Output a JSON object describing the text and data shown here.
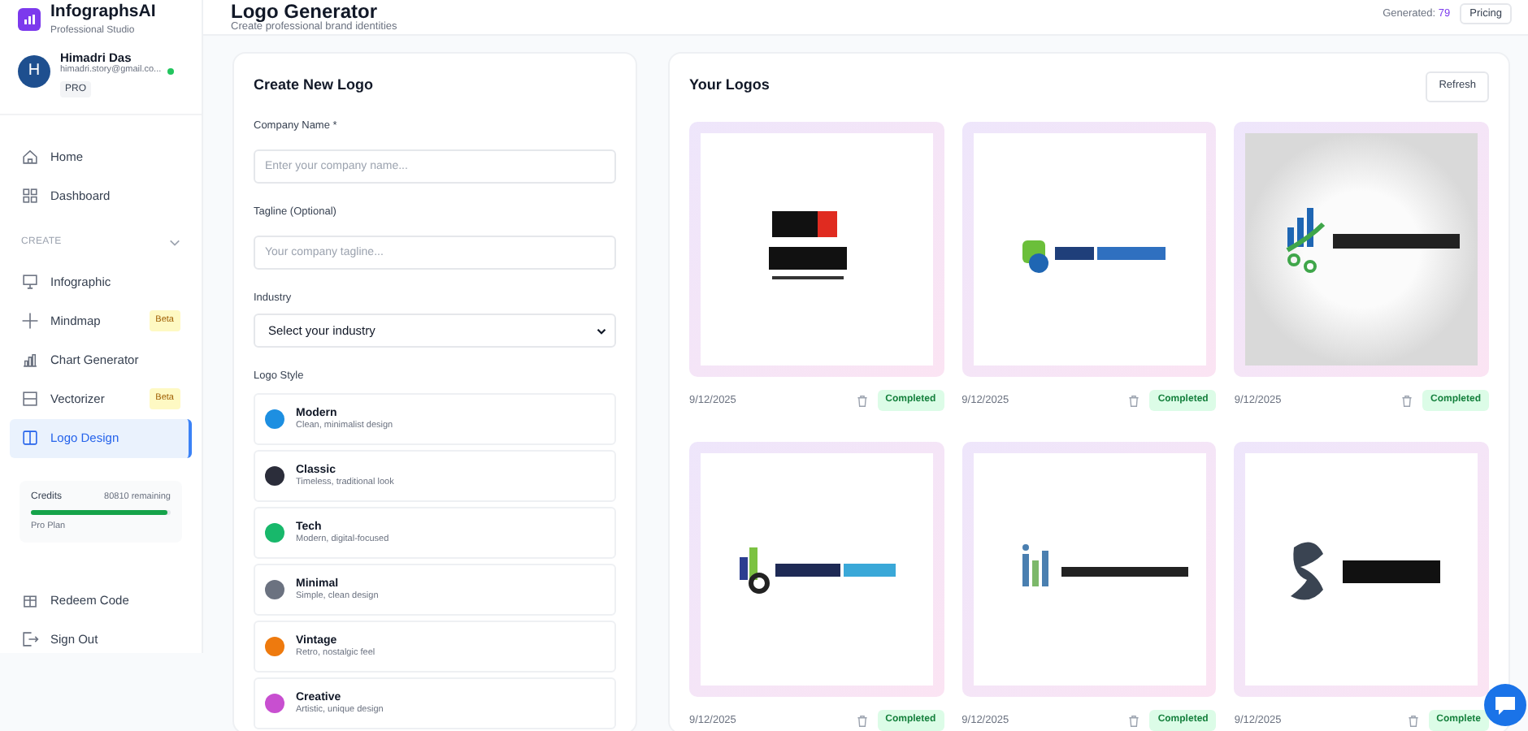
{
  "sidebar": {
    "brand": {
      "name": "InfographsAI",
      "subtitle": "Professional Studio"
    },
    "user": {
      "initial": "H",
      "name": "Himadri Das",
      "email": "himadri.story@gmail.co...",
      "online": true,
      "plan": "PRO"
    },
    "nav": [
      {
        "label": "Home",
        "selected": false
      },
      {
        "label": "Dashboard",
        "selected": false
      }
    ],
    "section": {
      "label": "CREATE",
      "expanded": true,
      "items": [
        {
          "label": "Infographic",
          "selected": false
        },
        {
          "label": "Mindmap",
          "badge": "Beta",
          "selected": false
        },
        {
          "label": "Chart Generator",
          "selected": false
        },
        {
          "label": "Vectorizer",
          "badge": "Beta",
          "selected": false
        },
        {
          "label": "Logo Design",
          "selected": true
        }
      ]
    },
    "credits": {
      "label": "Credits",
      "remaining": "80810 remaining",
      "level": 0.98,
      "plan": "Pro Plan"
    },
    "footer_items": [
      {
        "label": "Redeem Code"
      },
      {
        "label": "Sign Out"
      }
    ]
  },
  "header": {
    "title": "Logo Generator",
    "subtitle": "Create professional brand identities",
    "generated_label": "Generated:",
    "generated_count": "79",
    "pricing": "Pricing"
  },
  "form": {
    "title": "Create New Logo",
    "company": {
      "label": "Company Name *",
      "placeholder": "Enter your company name..."
    },
    "tagline": {
      "label": "Tagline (Optional)",
      "placeholder": "Your company tagline..."
    },
    "industry": {
      "label": "Industry",
      "value": "Select your industry"
    },
    "style_label": "Logo Style",
    "styles": [
      {
        "name": "Modern",
        "description": "Clean, minimalist design",
        "color": "#1d8fe1"
      },
      {
        "name": "Classic",
        "description": "Timeless, traditional look",
        "color": "#2b2d3a"
      },
      {
        "name": "Tech",
        "description": "Modern, digital-focused",
        "color": "#18b86b"
      },
      {
        "name": "Minimal",
        "description": "Simple, clean design",
        "color": "#6b7280"
      },
      {
        "name": "Vintage",
        "description": "Retro, nostalgic feel",
        "color": "#ee7a0e"
      },
      {
        "name": "Creative",
        "description": "Artistic, unique design",
        "color": "#c84fd0"
      }
    ]
  },
  "logos": {
    "title": "Your Logos",
    "refresh": "Refresh",
    "items": [
      {
        "kind": "picture",
        "date": "9/12/2025",
        "status": "Completed"
      },
      {
        "kind": "picture",
        "date": "9/12/2025",
        "status": "Completed"
      },
      {
        "kind": "picture",
        "date": "9/12/2025",
        "status": "Completed"
      },
      {
        "kind": "picture",
        "date": "9/12/2025",
        "status": "Completed"
      },
      {
        "kind": "picture",
        "date": "9/12/2025",
        "status": "Completed"
      },
      {
        "kind": "picture",
        "date": "9/12/2025",
        "status": "Complete"
      }
    ]
  }
}
